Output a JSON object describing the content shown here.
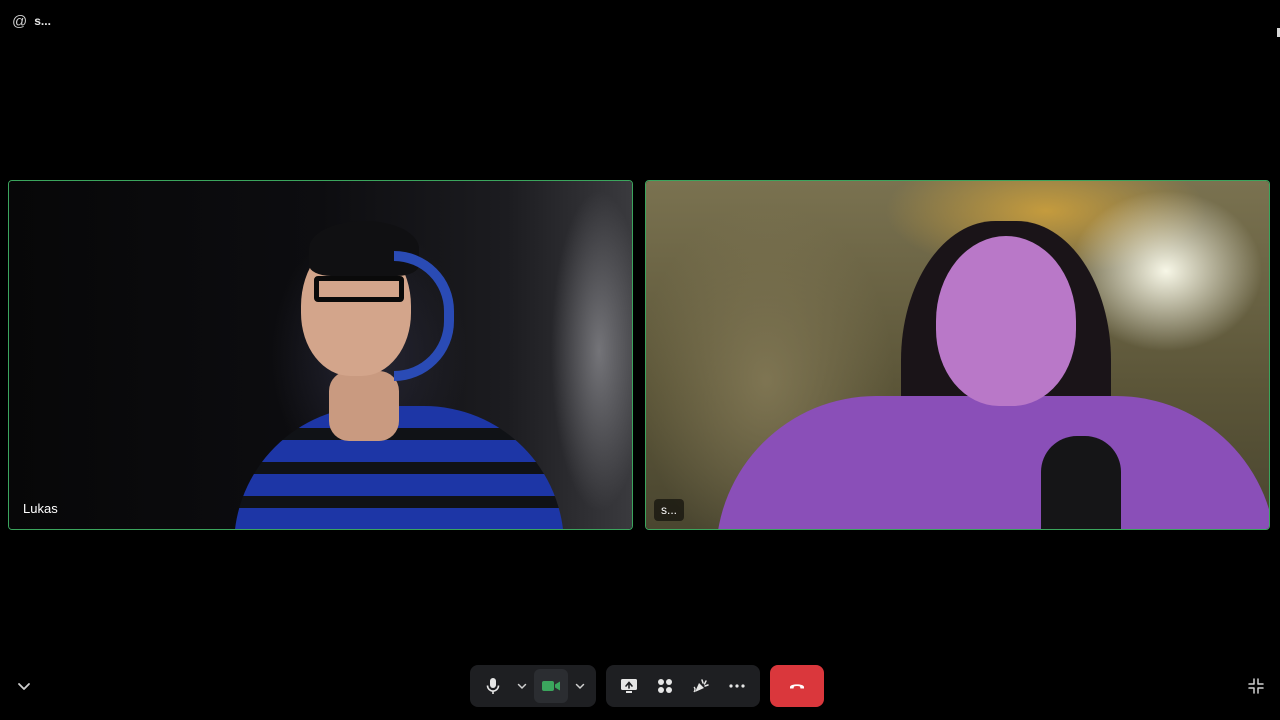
{
  "header": {
    "channel_icon": "at-icon",
    "channel_symbol": "@",
    "channel_name": "s..."
  },
  "participants": [
    {
      "name": "Lukas",
      "speaking": true
    },
    {
      "name": "s...",
      "speaking": true
    }
  ],
  "controls": {
    "microphone": {
      "icon": "microphone-icon",
      "muted": false
    },
    "microphone_options": {
      "icon": "chevron-down-icon"
    },
    "camera": {
      "icon": "camera-icon",
      "on": true
    },
    "camera_options": {
      "icon": "chevron-down-icon"
    },
    "screen_share": {
      "icon": "screen-share-icon"
    },
    "activities": {
      "icon": "activities-icon"
    },
    "soundboard": {
      "icon": "soundboard-icon"
    },
    "more": {
      "icon": "more-icon"
    },
    "disconnect": {
      "icon": "phone-hangup-icon"
    }
  },
  "colors": {
    "speaking_border": "#3ba55d",
    "camera_active": "#3ba55d",
    "disconnect": "#da373c",
    "control_group": "#1e1f22",
    "background": "#000000"
  }
}
